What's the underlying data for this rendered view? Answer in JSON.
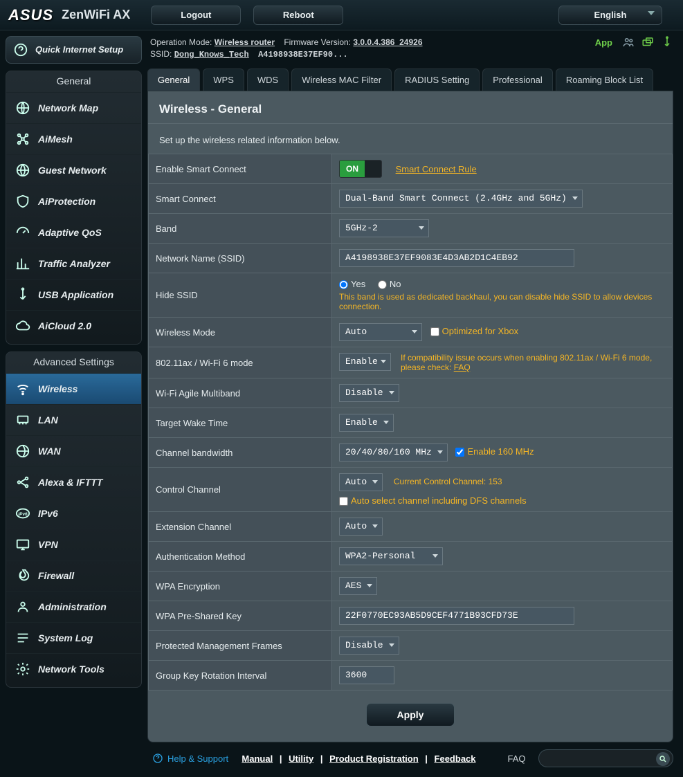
{
  "header": {
    "brand": "ASUS",
    "model": "ZenWiFi AX",
    "logout": "Logout",
    "reboot": "Reboot",
    "language": "English"
  },
  "info": {
    "op_mode_label": "Operation Mode:",
    "op_mode": "Wireless router",
    "fw_label": "Firmware Version:",
    "fw": "3.0.0.4.386_24926",
    "ssid_label": "SSID:",
    "ssid1": "Dong_Knows_Tech",
    "ssid2": "A4198938E37EF90...",
    "app": "App"
  },
  "sidebar": {
    "qis": "Quick Internet Setup",
    "general_head": "General",
    "general": [
      "Network Map",
      "AiMesh",
      "Guest Network",
      "AiProtection",
      "Adaptive QoS",
      "Traffic Analyzer",
      "USB Application",
      "AiCloud 2.0"
    ],
    "advanced_head": "Advanced Settings",
    "advanced": [
      "Wireless",
      "LAN",
      "WAN",
      "Alexa & IFTTT",
      "IPv6",
      "VPN",
      "Firewall",
      "Administration",
      "System Log",
      "Network Tools"
    ]
  },
  "tabs": [
    "General",
    "WPS",
    "WDS",
    "Wireless MAC Filter",
    "RADIUS Setting",
    "Professional",
    "Roaming Block List"
  ],
  "panel": {
    "title": "Wireless - General",
    "desc": "Set up the wireless related information below.",
    "rows": {
      "enable_smart": "Enable Smart Connect",
      "smart_rule": "Smart Connect Rule",
      "smart_connect_lbl": "Smart Connect",
      "smart_connect": "Dual-Band Smart Connect (2.4GHz and 5GHz)",
      "band_lbl": "Band",
      "band": "5GHz-2",
      "ssid_lbl": "Network Name (SSID)",
      "ssid_val": "A4198938E37EF9083E4D3AB2D1C4EB92",
      "hide_lbl": "Hide SSID",
      "hide_yes": "Yes",
      "hide_no": "No",
      "hide_help": "This band is used as dedicated backhaul, you can disable hide SSID to allow devices connection.",
      "wmode_lbl": "Wireless Mode",
      "wmode": "Auto",
      "xbox": "Optimized for Xbox",
      "ax_lbl": "802.11ax / Wi-Fi 6 mode",
      "ax_val": "Enable",
      "ax_help": "If compatibility issue occurs when enabling 802.11ax / Wi-Fi 6 mode, please check: ",
      "faq": "FAQ",
      "agile_lbl": "Wi-Fi Agile Multiband",
      "agile": "Disable",
      "twt_lbl": "Target Wake Time",
      "twt": "Enable",
      "bw_lbl": "Channel bandwidth",
      "bw": "20/40/80/160 MHz",
      "bw_chk": "Enable 160 MHz",
      "ctrl_lbl": "Control Channel",
      "ctrl": "Auto",
      "ctrl_help": "Current Control Channel: 153",
      "ctrl_dfs": "Auto select channel including DFS channels",
      "ext_lbl": "Extension Channel",
      "ext": "Auto",
      "auth_lbl": "Authentication Method",
      "auth": "WPA2-Personal",
      "enc_lbl": "WPA Encryption",
      "enc": "AES",
      "psk_lbl": "WPA Pre-Shared Key",
      "psk": "22F0770EC93AB5D9CEF4771B93CFD73E",
      "pmf_lbl": "Protected Management Frames",
      "pmf": "Disable",
      "gkr_lbl": "Group Key Rotation Interval",
      "gkr": "3600"
    },
    "on": "ON",
    "apply": "Apply"
  },
  "footer": {
    "help": "Help & Support",
    "links": [
      "Manual",
      "Utility",
      "Product Registration",
      "Feedback"
    ],
    "faq": "FAQ"
  }
}
